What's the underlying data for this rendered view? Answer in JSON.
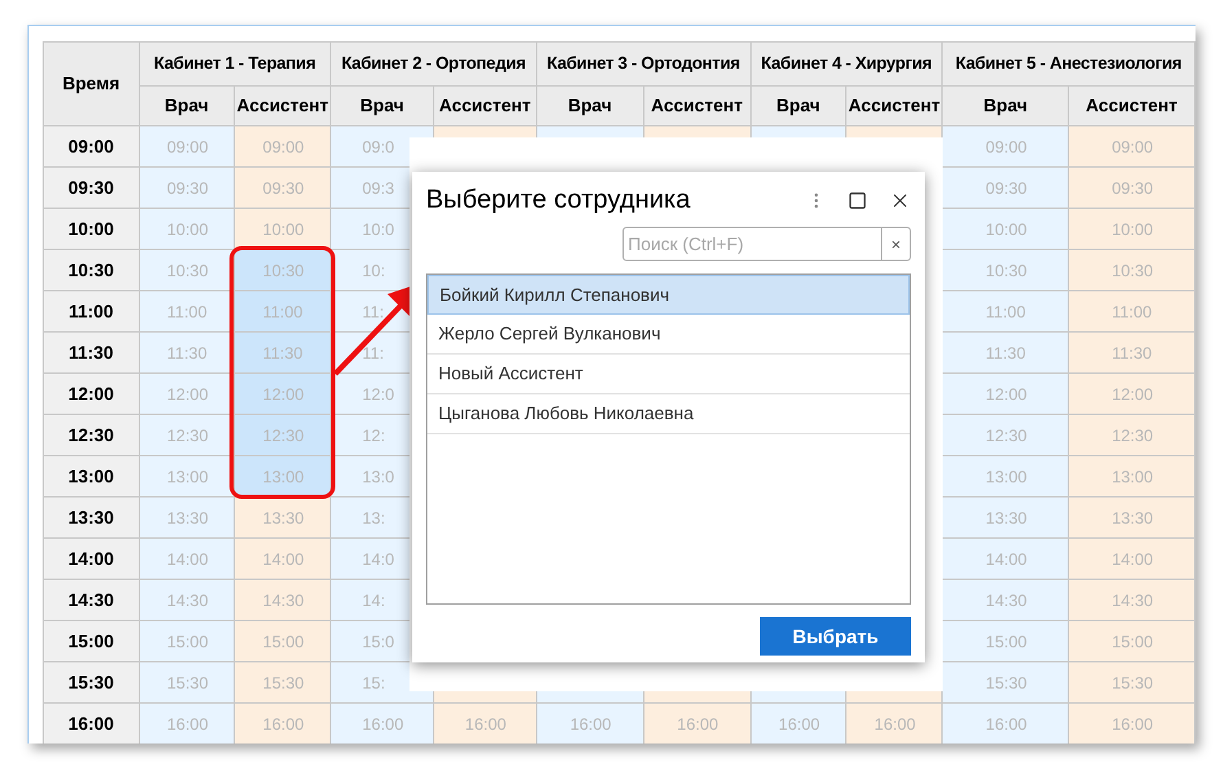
{
  "table": {
    "time_header": "Время",
    "rooms": [
      {
        "name": "Кабинет 1 - Терапия",
        "roles": [
          {
            "label": "Врач",
            "kind": "doctor"
          },
          {
            "label": "Ассистент",
            "kind": "assistant"
          }
        ]
      },
      {
        "name": "Кабинет 2 - Ортопедия",
        "roles": [
          {
            "label": "Врач",
            "kind": "doctor"
          },
          {
            "label": "Ассистент",
            "kind": "assistant"
          }
        ]
      },
      {
        "name": "Кабинет 3 - Ортодонтия",
        "roles": [
          {
            "label": "Врач",
            "kind": "doctor"
          },
          {
            "label": "Ассистент",
            "kind": "assistant"
          }
        ]
      },
      {
        "name": "Кабинет 4 - Хирургия",
        "roles": [
          {
            "label": "Врач",
            "kind": "doctor"
          },
          {
            "label": "Ассистент",
            "kind": "assistant"
          }
        ]
      },
      {
        "name": "Кабинет 5 - Анестезиология",
        "roles": [
          {
            "label": "Врач",
            "kind": "doctor"
          },
          {
            "label": "Ассистент",
            "kind": "assistant"
          }
        ]
      }
    ],
    "rows": [
      {
        "time": "09:00",
        "cells": [
          {
            "text": "09:00",
            "selected": false
          },
          {
            "text": "09:00",
            "selected": false
          },
          {
            "text": "09:0",
            "selected": false
          },
          null,
          null,
          null,
          null,
          null,
          {
            "text": "09:00",
            "selected": false
          },
          {
            "text": "09:00",
            "selected": false
          }
        ]
      },
      {
        "time": "09:30",
        "cells": [
          {
            "text": "09:30",
            "selected": false
          },
          {
            "text": "09:30",
            "selected": false
          },
          {
            "text": "09:3",
            "selected": false
          },
          null,
          null,
          null,
          null,
          null,
          {
            "text": "09:30",
            "selected": false
          },
          {
            "text": "09:30",
            "selected": false
          }
        ]
      },
      {
        "time": "10:00",
        "cells": [
          {
            "text": "10:00",
            "selected": false
          },
          {
            "text": "10:00",
            "selected": false
          },
          {
            "text": "10:0",
            "selected": false
          },
          null,
          null,
          null,
          null,
          null,
          {
            "text": "10:00",
            "selected": false
          },
          {
            "text": "10:00",
            "selected": false
          }
        ]
      },
      {
        "time": "10:30",
        "cells": [
          {
            "text": "10:30",
            "selected": false
          },
          {
            "text": "10:30",
            "selected": true
          },
          {
            "text": "10:",
            "selected": false
          },
          null,
          null,
          null,
          null,
          null,
          {
            "text": "10:30",
            "selected": false
          },
          {
            "text": "10:30",
            "selected": false
          }
        ]
      },
      {
        "time": "11:00",
        "cells": [
          {
            "text": "11:00",
            "selected": false
          },
          {
            "text": "11:00",
            "selected": true
          },
          {
            "text": "11:",
            "selected": false
          },
          null,
          null,
          null,
          null,
          null,
          {
            "text": "11:00",
            "selected": false
          },
          {
            "text": "11:00",
            "selected": false
          }
        ]
      },
      {
        "time": "11:30",
        "cells": [
          {
            "text": "11:30",
            "selected": false
          },
          {
            "text": "11:30",
            "selected": true
          },
          {
            "text": "11:",
            "selected": false
          },
          null,
          null,
          null,
          null,
          null,
          {
            "text": "11:30",
            "selected": false
          },
          {
            "text": "11:30",
            "selected": false
          }
        ]
      },
      {
        "time": "12:00",
        "cells": [
          {
            "text": "12:00",
            "selected": false
          },
          {
            "text": "12:00",
            "selected": true
          },
          {
            "text": "12:0",
            "selected": false
          },
          null,
          null,
          null,
          null,
          null,
          {
            "text": "12:00",
            "selected": false
          },
          {
            "text": "12:00",
            "selected": false
          }
        ]
      },
      {
        "time": "12:30",
        "cells": [
          {
            "text": "12:30",
            "selected": false
          },
          {
            "text": "12:30",
            "selected": true
          },
          {
            "text": "12:",
            "selected": false
          },
          null,
          null,
          null,
          null,
          null,
          {
            "text": "12:30",
            "selected": false
          },
          {
            "text": "12:30",
            "selected": false
          }
        ]
      },
      {
        "time": "13:00",
        "cells": [
          {
            "text": "13:00",
            "selected": false
          },
          {
            "text": "13:00",
            "selected": true
          },
          {
            "text": "13:0",
            "selected": false
          },
          null,
          null,
          null,
          null,
          null,
          {
            "text": "13:00",
            "selected": false
          },
          {
            "text": "13:00",
            "selected": false
          }
        ]
      },
      {
        "time": "13:30",
        "cells": [
          {
            "text": "13:30",
            "selected": false
          },
          {
            "text": "13:30",
            "selected": false
          },
          {
            "text": "13:",
            "selected": false
          },
          null,
          null,
          null,
          null,
          null,
          {
            "text": "13:30",
            "selected": false
          },
          {
            "text": "13:30",
            "selected": false
          }
        ]
      },
      {
        "time": "14:00",
        "cells": [
          {
            "text": "14:00",
            "selected": false
          },
          {
            "text": "14:00",
            "selected": false
          },
          {
            "text": "14:0",
            "selected": false
          },
          null,
          null,
          null,
          null,
          null,
          {
            "text": "14:00",
            "selected": false
          },
          {
            "text": "14:00",
            "selected": false
          }
        ]
      },
      {
        "time": "14:30",
        "cells": [
          {
            "text": "14:30",
            "selected": false
          },
          {
            "text": "14:30",
            "selected": false
          },
          {
            "text": "14:",
            "selected": false
          },
          null,
          null,
          null,
          null,
          null,
          {
            "text": "14:30",
            "selected": false
          },
          {
            "text": "14:30",
            "selected": false
          }
        ]
      },
      {
        "time": "15:00",
        "cells": [
          {
            "text": "15:00",
            "selected": false
          },
          {
            "text": "15:00",
            "selected": false
          },
          {
            "text": "15:0",
            "selected": false
          },
          null,
          null,
          null,
          null,
          null,
          {
            "text": "15:00",
            "selected": false
          },
          {
            "text": "15:00",
            "selected": false
          }
        ]
      },
      {
        "time": "15:30",
        "cells": [
          {
            "text": "15:30",
            "selected": false
          },
          {
            "text": "15:30",
            "selected": false
          },
          {
            "text": "15:",
            "selected": false
          },
          null,
          null,
          null,
          null,
          null,
          {
            "text": "15:30",
            "selected": false
          },
          {
            "text": "15:30",
            "selected": false
          }
        ]
      },
      {
        "time": "16:00",
        "cells": [
          {
            "text": "16:00",
            "selected": false
          },
          {
            "text": "16:00",
            "selected": false
          },
          {
            "text": "16:00",
            "selected": false
          },
          {
            "text": "16:00",
            "selected": false
          },
          {
            "text": "16:00",
            "selected": false
          },
          {
            "text": "16:00",
            "selected": false
          },
          {
            "text": "16:00",
            "selected": false
          },
          {
            "text": "16:00",
            "selected": false
          },
          {
            "text": "16:00",
            "selected": false
          },
          {
            "text": "16:00",
            "selected": false
          }
        ]
      }
    ]
  },
  "dialog": {
    "title": "Выберите сотрудника",
    "search": {
      "placeholder": "Поиск (Ctrl+F)",
      "clear": "×"
    },
    "items": [
      {
        "name": "Бойкий Кирилл Степанович",
        "selected": true
      },
      {
        "name": "Жерло Сергей Вулканович",
        "selected": false
      },
      {
        "name": "Новый Ассистент",
        "selected": false
      },
      {
        "name": "Цыганова Любовь Николаевна",
        "selected": false
      }
    ],
    "button": "Выбрать"
  }
}
